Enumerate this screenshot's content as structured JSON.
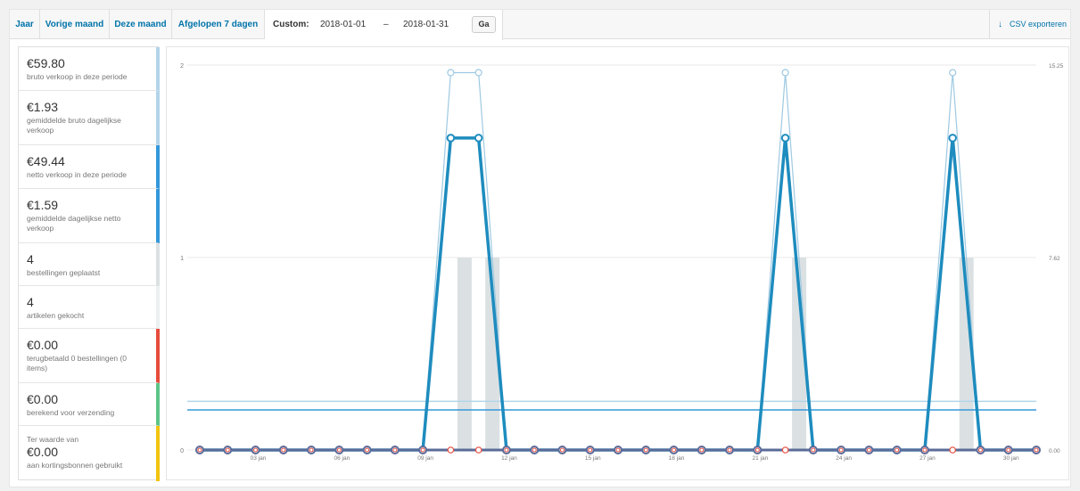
{
  "tabs": [
    "Jaar",
    "Vorige maand",
    "Deze maand",
    "Afgelopen 7 dagen"
  ],
  "custom": {
    "label": "Custom:",
    "from": "2018-01-01",
    "dash": "–",
    "to": "2018-01-31",
    "go_label": "Ga"
  },
  "export": {
    "label": "CSV exporteren",
    "icon": "download-arrow-icon"
  },
  "legend": [
    {
      "amount": "€59.80",
      "desc": "bruto verkoop in deze periode",
      "color": "#b1d4ea"
    },
    {
      "amount": "€1.93",
      "desc": "gemiddelde bruto dagelijkse verkoop",
      "color": "#b1d4ea"
    },
    {
      "amount": "€49.44",
      "desc": "netto verkoop in deze periode",
      "color": "#3498db"
    },
    {
      "amount": "€1.59",
      "desc": "gemiddelde dagelijkse netto verkoop",
      "color": "#3498db"
    },
    {
      "amount": "4",
      "desc": "bestellingen geplaatst",
      "color": "#dbe1e3"
    },
    {
      "amount": "4",
      "desc": "artikelen gekocht",
      "color": "#ecf0f1"
    },
    {
      "amount": "€0.00",
      "desc": "terugbetaald 0 bestellingen (0 items)",
      "color": "#e74c3c"
    },
    {
      "amount": "€0.00",
      "desc": "berekend voor verzending",
      "color": "#5cc488"
    },
    {
      "amount": "€0.00",
      "prefix": "Ter waarde van",
      "desc": "aan kortingsbonnen gebruikt",
      "color": "#f1c40f"
    }
  ],
  "chart_data": {
    "type": "line",
    "x_days": [
      1,
      2,
      3,
      4,
      5,
      6,
      7,
      8,
      9,
      10,
      11,
      12,
      13,
      14,
      15,
      16,
      17,
      18,
      19,
      20,
      21,
      22,
      23,
      24,
      25,
      26,
      27,
      28,
      29,
      30,
      31
    ],
    "x_tick_labels": [
      "03 jan",
      "06 jan",
      "09 jan",
      "12 jan",
      "15 jan",
      "18 jan",
      "21 jan",
      "24 jan",
      "27 jan",
      "30 jan"
    ],
    "x_tick_days": [
      3,
      6,
      9,
      12,
      15,
      18,
      21,
      24,
      27,
      30
    ],
    "left_axis": {
      "ticks": [
        "0",
        "1",
        "2"
      ],
      "ylim": [
        0,
        2
      ]
    },
    "right_axis": {
      "ticks": [
        "0.00",
        "7.62",
        "15.25"
      ],
      "ylim": [
        0,
        15.25
      ]
    },
    "series": [
      {
        "name": "bestellingen geplaatst",
        "kind": "bar",
        "axis": "left",
        "color": "#dbe1e3",
        "values": [
          0,
          0,
          0,
          0,
          0,
          0,
          0,
          0,
          0,
          1,
          1,
          0,
          0,
          0,
          0,
          0,
          0,
          0,
          0,
          0,
          0,
          1,
          0,
          0,
          0,
          0,
          0,
          1,
          0,
          0,
          0
        ]
      },
      {
        "name": "bruto verkoop",
        "kind": "line",
        "axis": "right",
        "color": "#b1d4ea",
        "values": [
          0,
          0,
          0,
          0,
          0,
          0,
          0,
          0,
          0,
          14.95,
          14.95,
          0,
          0,
          0,
          0,
          0,
          0,
          0,
          0,
          0,
          0,
          14.95,
          0,
          0,
          0,
          0,
          0,
          14.95,
          0,
          0,
          0
        ]
      },
      {
        "name": "netto verkoop",
        "kind": "line",
        "axis": "right",
        "color": "#1e8cbe",
        "values": [
          0,
          0,
          0,
          0,
          0,
          0,
          0,
          0,
          0,
          12.36,
          12.36,
          0,
          0,
          0,
          0,
          0,
          0,
          0,
          0,
          0,
          0,
          12.36,
          0,
          0,
          0,
          0,
          0,
          12.36,
          0,
          0,
          0
        ]
      },
      {
        "name": "terugbetaald",
        "kind": "line",
        "axis": "right",
        "color": "#e74c3c",
        "values": [
          0,
          0,
          0,
          0,
          0,
          0,
          0,
          0,
          0,
          0,
          0,
          0,
          0,
          0,
          0,
          0,
          0,
          0,
          0,
          0,
          0,
          0,
          0,
          0,
          0,
          0,
          0,
          0,
          0,
          0,
          0
        ]
      },
      {
        "name": "verzending",
        "kind": "line",
        "axis": "right",
        "color": "#5b6b99",
        "values": [
          0,
          0,
          0,
          0,
          0,
          0,
          0,
          0,
          0,
          0,
          0,
          0,
          0,
          0,
          0,
          0,
          0,
          0,
          0,
          0,
          0,
          0,
          0,
          0,
          0,
          0,
          0,
          0,
          0,
          0,
          0
        ]
      }
    ],
    "averages": [
      {
        "name": "gemiddelde bruto dagelijkse verkoop",
        "value": 1.93,
        "axis": "right",
        "color": "#b1d4ea"
      },
      {
        "name": "gemiddelde dagelijkse netto verkoop",
        "value": 1.59,
        "axis": "right",
        "color": "#3498db"
      }
    ],
    "grid": true
  }
}
